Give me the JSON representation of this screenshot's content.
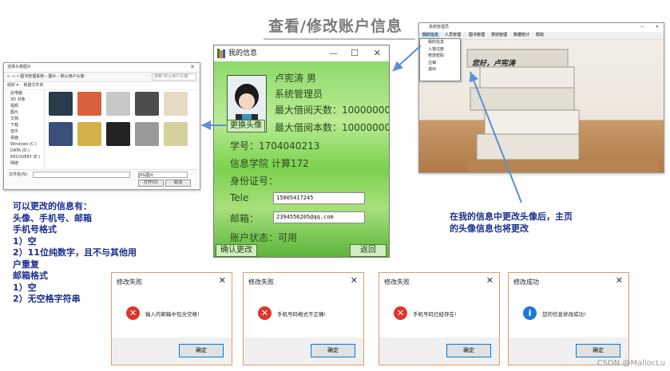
{
  "slide": {
    "title": "查看/修改账户信息",
    "watermark": "CSDN @MallocLu",
    "note_left": [
      "可以更改的信息有：",
      "头像、手机号、邮箱",
      "手机号格式",
      "1）空",
      "2）11位纯数字，且不与其他用",
      "户重复",
      "邮箱格式",
      "1）空",
      "2）无空格字符串"
    ],
    "note_right": [
      "在我的信息中更改头像后，主页",
      "的头像信息也将更改"
    ]
  },
  "file_picker": {
    "title": "选择头像图片",
    "nav_path": "« 图书管理系统 › 图片 › 默认用户头像",
    "search_placeholder": "搜索\"默认用户头像\"",
    "toolbar": [
      "组织 ▾",
      "新建文件夹"
    ],
    "sidebar_items": [
      "此电脑",
      "3D 对象",
      "视频",
      "图片",
      "文档",
      "下载",
      "音乐",
      "桌面",
      "Windows (C:)",
      "DATA (D:)",
      "RECOVERY (E:)",
      "网络"
    ],
    "filename_label": "文件名(N):",
    "filter_label": "JPG图片",
    "open_label": "打开(O)",
    "cancel_label": "取消"
  },
  "info_dialog": {
    "title": "我的信息",
    "controls": {
      "minimize": "—",
      "maximize": "☐",
      "close": "✕"
    },
    "name_line": "卢宪涛  男",
    "role": "系统管理员",
    "max_days": "最大借阅天数：10000000",
    "max_books": "最大借阅本数：10000000",
    "change_avatar_label": "更换头像",
    "student_id": "学号：1704040213",
    "college": "信息学院  计算172",
    "id_card": "身份证号：",
    "phone_label": "Tele",
    "phone_value": "15005417245",
    "email_label": "邮箱：",
    "email_value": "2394556205@qq.com",
    "account_status": "账户状态：可用",
    "confirm_label": "确认更改",
    "back_label": "返回"
  },
  "main_window": {
    "title": "系统管理员",
    "menu": [
      "我的信息",
      "人员管理",
      "图书管理",
      "类别管理",
      "数据统计",
      "帮助"
    ],
    "dropdown": [
      "我的信息",
      "入馆注册",
      "修改密码",
      "注销",
      "退出"
    ],
    "greeting": "您好，卢宪涛"
  },
  "message_boxes": [
    {
      "title": "修改失败",
      "message": "输入的邮箱中包含空格!",
      "icon": "error-icon",
      "ok": "确定"
    },
    {
      "title": "修改失败",
      "message": "手机号码格式不正确!",
      "icon": "error-icon",
      "ok": "确定"
    },
    {
      "title": "修改失败",
      "message": "手机号码已经存在!",
      "icon": "error-icon",
      "ok": "确定"
    },
    {
      "title": "修改成功",
      "message": "您的信息修改成功!",
      "icon": "info-icon",
      "ok": "确定"
    }
  ],
  "colors": {
    "accent_blue": "#1a2d8f",
    "dialog_green": "#6ecc45",
    "error_red": "#e0352b",
    "info_blue": "#1e78d4",
    "arrow_blue": "#5b8fd6"
  }
}
